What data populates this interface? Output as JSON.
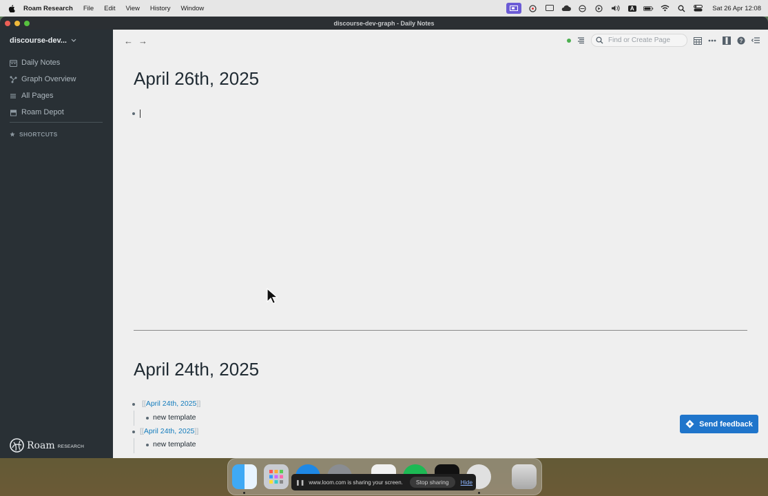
{
  "menubar": {
    "app_name": "Roam Research",
    "menus": [
      "File",
      "Edit",
      "View",
      "History",
      "Window"
    ],
    "clock": "Sat 26 Apr  12:08",
    "status_icons": [
      "screen-share-icon",
      "pinwheel-icon",
      "display-icon",
      "creative-cloud-icon",
      "vpn-icon",
      "play-icon",
      "volume-icon",
      "input-source-icon",
      "battery-icon",
      "wifi-icon",
      "spotlight-icon",
      "control-center-icon"
    ],
    "input_source_label": "A"
  },
  "window": {
    "title": "discourse-dev-graph - Daily Notes"
  },
  "sidebar": {
    "graph_name": "discourse-dev...",
    "nav_items": [
      {
        "label": "Daily Notes",
        "icon": "calendar-icon"
      },
      {
        "label": "Graph Overview",
        "icon": "graph-icon"
      },
      {
        "label": "All Pages",
        "icon": "list-icon"
      },
      {
        "label": "Roam Depot",
        "icon": "store-icon"
      }
    ],
    "shortcuts_label": "SHORTCUTS",
    "logo_word": "Roam",
    "logo_sub": "RESEARCH"
  },
  "topbar": {
    "back": "←",
    "forward": "→",
    "search_placeholder": "Find or Create Page",
    "sync_color": "#4caf50"
  },
  "pages": [
    {
      "title": "April 26th, 2025",
      "blocks": []
    },
    {
      "title": "April 24th, 2025",
      "blocks": [
        {
          "open": "[[",
          "ref": "April 24th, 2025",
          "close": "]]",
          "child": "new template"
        },
        {
          "open": "[[",
          "ref": "April 24th, 2025",
          "close": "]]",
          "child": "new template"
        }
      ]
    }
  ],
  "feedback_button": "Send feedback",
  "share_banner": {
    "message": "www.loom.com is sharing your screen.",
    "stop": "Stop sharing",
    "hide": "Hide"
  },
  "dock": {
    "apps": [
      "finder-icon",
      "launchpad-icon",
      "safari-icon",
      "settings-icon",
      "music-icon",
      "spotify-icon",
      "terminal-icon",
      "browser-icon",
      "trash-icon"
    ]
  },
  "colors": {
    "accent": "#1f75cb",
    "link": "#137cbd",
    "sidebar_bg": "#293035"
  }
}
